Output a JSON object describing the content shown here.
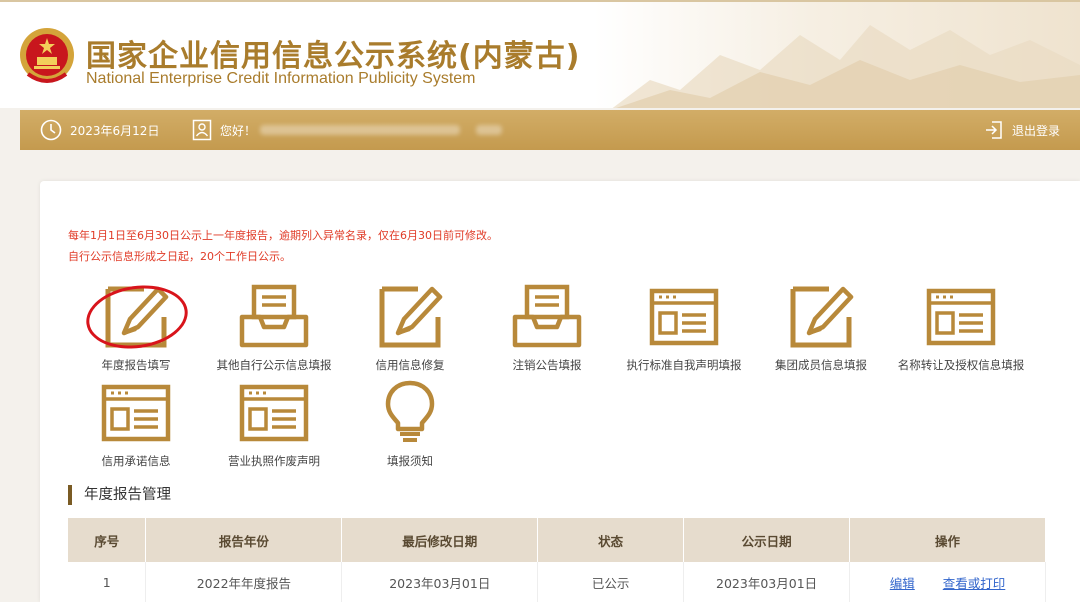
{
  "header": {
    "title_cn": "国家企业信用信息公示系统(内蒙古)",
    "title_en": "National Enterprise Credit Information Publicity System"
  },
  "topbar": {
    "date": "2023年6月12日",
    "greeting": "您好！",
    "logout": "退出登录"
  },
  "notices": [
    "每年1月1日至6月30日公示上一年度报告，逾期列入异常名录，仅在6月30日前可修改。",
    "自行公示信息形成之日起，20个工作日公示。"
  ],
  "tiles": [
    {
      "label": "年度报告填写",
      "icon": "pencil-icon"
    },
    {
      "label": "其他自行公示信息填报",
      "icon": "inbox-tray-icon"
    },
    {
      "label": "信用信息修复",
      "icon": "pencil-icon"
    },
    {
      "label": "注销公告填报",
      "icon": "inbox-tray-icon"
    },
    {
      "label": "执行标准自我声明填报",
      "icon": "form-card-icon"
    },
    {
      "label": "集团成员信息填报",
      "icon": "pencil-icon"
    },
    {
      "label": "名称转让及授权信息填报",
      "icon": "form-card-icon"
    },
    {
      "label": "信用承诺信息",
      "icon": "form-card-icon"
    },
    {
      "label": "营业执照作废声明",
      "icon": "form-card-icon"
    },
    {
      "label": "填报须知",
      "icon": "lightbulb-icon"
    }
  ],
  "section_title": "年度报告管理",
  "table": {
    "headers": [
      "序号",
      "报告年份",
      "最后修改日期",
      "状态",
      "公示日期",
      "操作"
    ],
    "rows": [
      {
        "no": "1",
        "year": "2022年年度报告",
        "modified": "2023年03月01日",
        "status": "已公示",
        "published": "2023年03月01日",
        "action_edit": "编辑",
        "action_view": "查看或打印"
      }
    ]
  },
  "colors": {
    "gold": "#c49a4e",
    "icon_gold": "#b8893a",
    "notice_red": "#e03b27",
    "highlight_circle": "#d8141b",
    "link_blue": "#3366cc"
  }
}
